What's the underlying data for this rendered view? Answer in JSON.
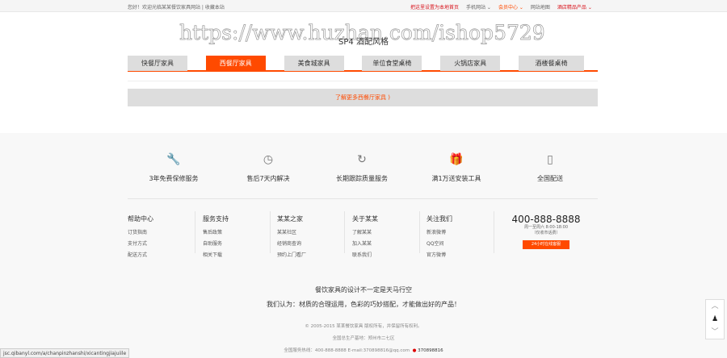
{
  "topbar": {
    "welcome": "您好！欢迎光临某某餐饮家具网站",
    "favorite": "收藏本站",
    "right": [
      {
        "label": "把这里设置为本地首页",
        "cls": "red"
      },
      {
        "label": "手机网站 ⌄",
        "cls": ""
      },
      {
        "label": "会员中心 ⌄",
        "cls": "or"
      },
      {
        "label": "网站地图",
        "cls": ""
      },
      {
        "label": "酒店精品产品 ⌄",
        "cls": "red"
      }
    ]
  },
  "watermark": "https://www.huzhan.com/ishop5729",
  "section_title": "SP4 酒配风格",
  "tabs": [
    {
      "label": "快餐厅家具"
    },
    {
      "label": "西餐厅家具",
      "active": true
    },
    {
      "label": "美食城家具"
    },
    {
      "label": "单位食堂桌椅"
    },
    {
      "label": "火锅店家具"
    },
    {
      "label": "酒楼餐桌椅"
    }
  ],
  "more_button": "了解更多西餐厅家具 )",
  "services": [
    {
      "icon": "wrench-icon",
      "glyph": "🔧",
      "label": "3年免费保修服务"
    },
    {
      "icon": "clock-icon",
      "glyph": "◷",
      "label": "售后7天内解决"
    },
    {
      "icon": "refresh-icon",
      "glyph": "↻",
      "label": "长期跟踪质量服务"
    },
    {
      "icon": "gift-icon",
      "glyph": "🎁",
      "label": "满1万送安装工具"
    },
    {
      "icon": "map-icon",
      "glyph": "▯",
      "label": "全国配送"
    }
  ],
  "columns": [
    {
      "title": "帮助中心",
      "links": [
        "订货指南",
        "支付方式",
        "配送方式"
      ]
    },
    {
      "title": "服务支持",
      "links": [
        "售后政策",
        "自助服务",
        "相关下载"
      ]
    },
    {
      "title": "某某之家",
      "links": [
        "某某社区",
        "经销商查询",
        "预约上门看厂"
      ]
    },
    {
      "title": "关于某某",
      "links": [
        "了解某某",
        "加入某某",
        "联系我们"
      ]
    },
    {
      "title": "关注我们",
      "links": [
        "新浪微博",
        "QQ空间",
        "官方微博"
      ]
    }
  ],
  "hotline": {
    "number": "400-888-8888",
    "hours": "周一至周六 8:00-18:00",
    "note": "（仅收市话费）",
    "button": "24小时在线客服"
  },
  "slogan1": "餐饮家具的设计不一定是天马行空",
  "slogan2": "我们认为：材质的合理运用，色彩的巧妙搭配，才能做出好的产品！",
  "copyright": "© 2005-2015 某某餐饮家具 版权所有，并保留所有权利。",
  "address": "全国总生产基地：郑州市二七区",
  "contact": "全国服务热线：400-888-8888   E-mail:370898816@qq.com",
  "qq": "370898816",
  "status_url": "jsc.qibanyl.com/a/chanpinzhanshi/xicantingjiajuiile"
}
